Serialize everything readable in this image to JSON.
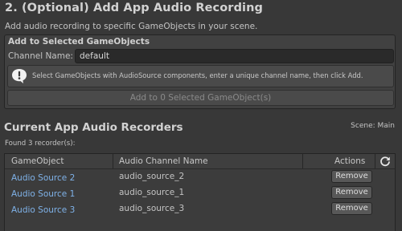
{
  "section": {
    "title": "2. (Optional) Add App Audio Recording",
    "description": "Add audio recording to specific GameObjects in your scene."
  },
  "add_box": {
    "title": "Add to Selected GameObjects",
    "channel_label": "Channel Name:",
    "channel_value": "default",
    "help_text": "Select GameObjects with AudioSource components, enter a unique channel name, then click Add.",
    "add_button": "Add to 0 Selected GameObject(s)",
    "add_button_enabled": false
  },
  "recorders": {
    "title": "Current App Audio Recorders",
    "scene_label": "Scene: Main",
    "found_label": "Found 3 recorder(s):",
    "columns": {
      "gameobject": "GameObject",
      "channel": "Audio Channel Name",
      "actions": "Actions"
    },
    "rows": [
      {
        "name": "Audio Source 2",
        "channel": "audio_source_2",
        "action": "Remove"
      },
      {
        "name": "Audio Source 1",
        "channel": "audio_source_1",
        "action": "Remove"
      },
      {
        "name": "Audio Source 3",
        "channel": "audio_source_3",
        "action": "Remove"
      }
    ]
  },
  "icons": {
    "help": "speech-bubble-exclamation-icon",
    "refresh": "refresh-icon"
  },
  "colors": {
    "background": "#383838",
    "link": "#7fb2e8"
  }
}
